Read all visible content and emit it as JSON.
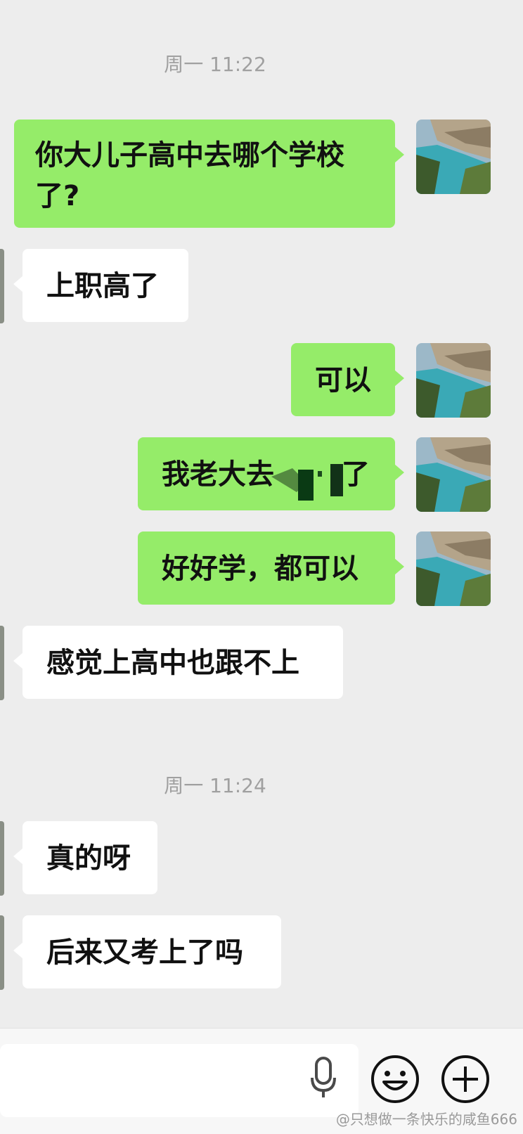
{
  "timestamps": [
    "周一 11:22",
    "周一 11:24"
  ],
  "messages": [
    {
      "side": "me",
      "text": "你大儿子高中去哪个学校了?"
    },
    {
      "side": "other",
      "text": "上职高了"
    },
    {
      "side": "me",
      "text": "可以"
    },
    {
      "side": "me",
      "text": "我老大去"
    },
    {
      "side": "me",
      "text": "了"
    },
    {
      "side": "me",
      "text": "好好学，都可以"
    },
    {
      "side": "other",
      "text": "感觉上高中也跟不上"
    },
    {
      "side": "other",
      "text": "真的呀"
    },
    {
      "side": "other",
      "text": "后来又考上了吗"
    }
  ],
  "toolbar": {
    "voice_icon": "microphone-icon",
    "emoji_icon": "smiley-icon",
    "more_icon": "plus-icon"
  },
  "watermark": "@只想做一条快乐的咸鱼666",
  "colors": {
    "background": "#ededed",
    "my_bubble": "#95ec69",
    "their_bubble": "#ffffff"
  }
}
